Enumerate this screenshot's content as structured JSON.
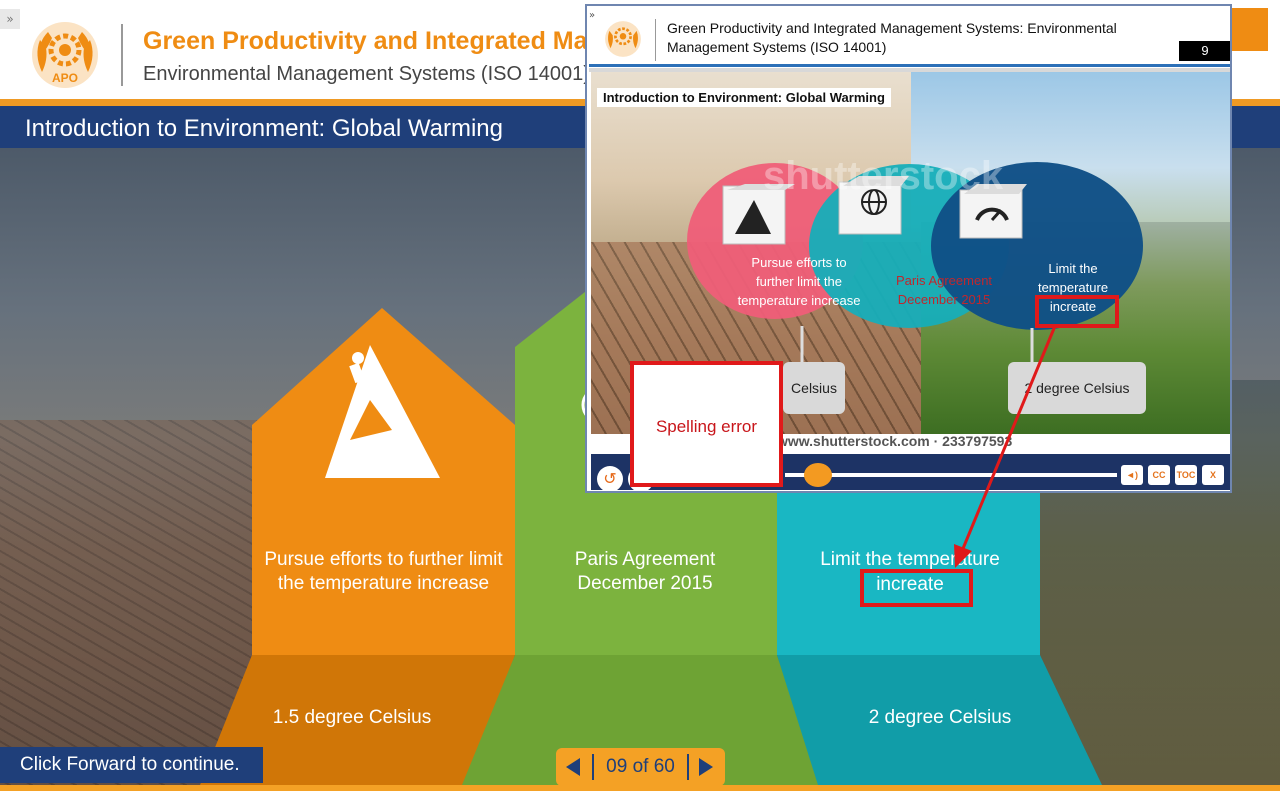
{
  "window": {
    "expand_icon": "double-chevron-right-icon",
    "logo_text": "APO"
  },
  "header": {
    "title": "Green Productivity and Integrated Mar",
    "subtitle": "Environmental Management Systems (ISO 14001)"
  },
  "slide": {
    "title": "Introduction to Environment: Global Warming",
    "pillars": [
      {
        "icon": "mountain-climber-icon",
        "text": "Pursue efforts to further limit the temperature increase",
        "degree": "1.5 degree Celsius",
        "color": "#ef8c13"
      },
      {
        "icon": "globe-icon",
        "text": "Paris Agreement December 2015",
        "degree": "",
        "color": "#7cb33e"
      },
      {
        "icon": "speedometer-icon",
        "text_line1": "Limit the temperature",
        "text_line2": "increate",
        "degree": "2 degree Celsius",
        "color": "#19b7c3"
      }
    ]
  },
  "footer": {
    "click_forward": "Click Forward to continue.",
    "pager_text": "09 of 60",
    "prev_icon": "triangle-left-icon",
    "next_icon": "triangle-right-icon"
  },
  "inset": {
    "title": "Green Productivity and Integrated Management Systems: Environmental Management Systems (ISO 14001)",
    "page_number": "9",
    "heading": "Introduction to Environment: Global Warming",
    "venn": [
      {
        "text": "Pursue efforts to further limit the temperature increase",
        "color": "#ffffff"
      },
      {
        "text": "Paris Agreement December 2015",
        "color": "#c0272d"
      },
      {
        "text": "Limit the temperature increate",
        "color": "#ffffff"
      }
    ],
    "celsius_left": "Celsius",
    "celsius_right": "2 degree Celsius",
    "watermark": "shutterstock",
    "url": "www.shutterstock.com · 233797593",
    "controls": [
      {
        "label": "◄)",
        "icon": "volume-icon"
      },
      {
        "label": "CC",
        "icon": "captions-icon"
      },
      {
        "label": "TOC",
        "icon": "toc-icon"
      },
      {
        "label": "X",
        "icon": "close-icon"
      }
    ],
    "replay_icon": "replay-icon"
  },
  "annotation": {
    "note": "Spelling error",
    "color": "#e0191a"
  }
}
